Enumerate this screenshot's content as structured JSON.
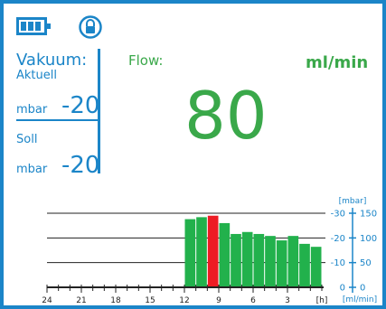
{
  "vakuum": {
    "title": "Vakuum:",
    "aktuell_label": "Aktuell",
    "aktuell_unit": "mbar",
    "aktuell_value": "-20",
    "soll_label": "Soll",
    "soll_unit": "mbar",
    "soll_value": "-20"
  },
  "flow": {
    "label": "Flow:",
    "unit": "ml/min",
    "value": "80"
  },
  "status_icons": {
    "battery": "battery-icon",
    "lock": "lock-icon"
  },
  "colors": {
    "accent_blue": "#1b85c8",
    "flow_green": "#3aa84a",
    "bar_green": "#22b14c",
    "bar_red": "#ed1c24"
  },
  "chart_data": {
    "type": "bar",
    "x_unit": "[h]",
    "x_ticks": [
      "24",
      "21",
      "18",
      "15",
      "12",
      "9",
      "6",
      "3"
    ],
    "x_range": [
      24,
      0
    ],
    "bars_hours_ago": [
      11.5,
      10.5,
      9.5,
      8.5,
      7.5,
      6.5,
      5.5,
      4.5,
      3.5,
      2.5,
      1.5,
      0.5
    ],
    "flow_values": [
      138,
      142,
      145,
      130,
      108,
      112,
      108,
      104,
      95,
      104,
      88,
      82
    ],
    "highlight_index": 2,
    "left_axis": {
      "label": "[mbar]",
      "ticks": [
        "-30",
        "-20",
        "-10",
        "0"
      ]
    },
    "right_axis": {
      "label": "[ml/min]",
      "ticks": [
        "150",
        "100",
        "50",
        "0"
      ]
    },
    "right_range": [
      0,
      150
    ]
  }
}
